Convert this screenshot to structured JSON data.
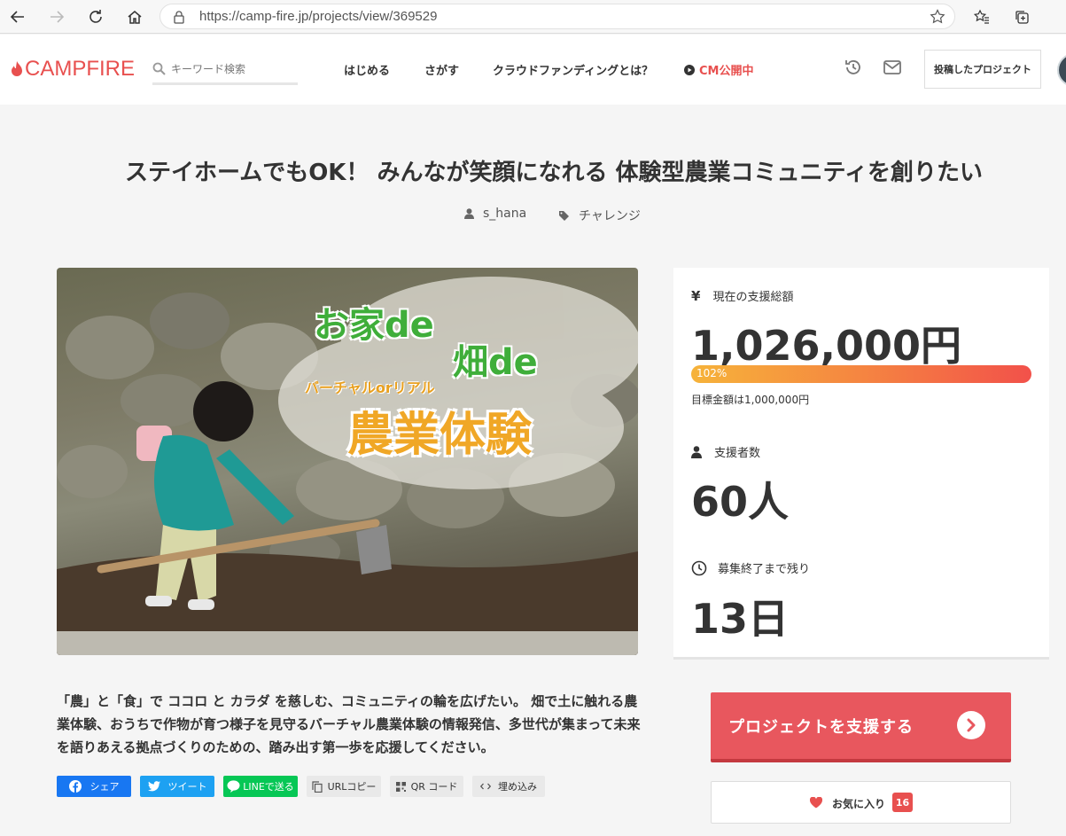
{
  "browser": {
    "url": "https://camp-fire.jp/projects/view/369529"
  },
  "header": {
    "logo": "CAMPFIRE",
    "search_placeholder": "キーワード検索",
    "nav": {
      "start": "はじめる",
      "explore": "さがす",
      "about": "クラウドファンディングとは？",
      "cm": "CM公開中"
    },
    "posted_projects": "投稿したプロジェクト"
  },
  "project": {
    "title": "ステイホームでもOK！ みんなが笑顔になれる 体験型農業コミュニティを創りたい",
    "author": "s_hana",
    "category": "チャレンジ",
    "hero": {
      "line1": "お家de",
      "line2": "畑de",
      "line3": "バーチャルorリアル",
      "line4": "農業体験"
    },
    "description": "「農」と「食」で ココロ と カラダ を慈しむ、コミュニティの輪を広げたい。 畑で土に触れる農業体験、おうちで作物が育つ様子を見守るバーチャル農業体験の情報発信、多世代が集まって未来を語りあえる拠点づくりのための、踏み出す第一歩を応援してください。"
  },
  "stats": {
    "total_label": "現在の支援総額",
    "total_value": "1,026,000円",
    "progress_text": "102%",
    "progress_fraction": 1.02,
    "goal_text": "目標金額は1,000,000円",
    "backers_label": "支援者数",
    "backers_value": "60人",
    "remaining_label": "募集終了まで残り",
    "remaining_value": "13日"
  },
  "share": {
    "facebook": "シェア",
    "twitter": "ツイート",
    "line": "LINEで送る",
    "url_copy": "URLコピー",
    "qr": "QR コード",
    "embed": "埋め込み"
  },
  "actions": {
    "support": "プロジェクトを支援する",
    "favorite": "お気に入り",
    "favorite_count": "16"
  },
  "colors": {
    "brand": "#e8504f",
    "support_button": "#e8575e",
    "facebook": "#1877f2",
    "twitter": "#1da1f2",
    "line": "#06c755"
  }
}
